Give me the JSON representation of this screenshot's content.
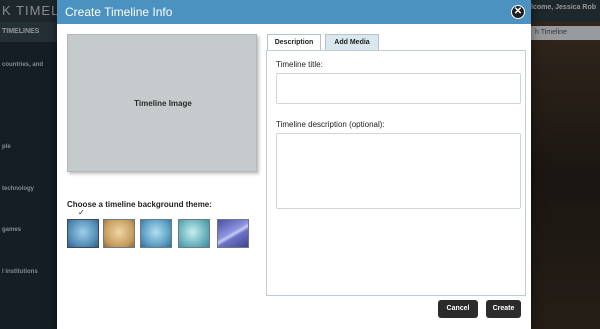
{
  "background_app": {
    "logo": "K TIMELINE",
    "welcome": "Welcome, Jessica Rob",
    "sidebar_header": "TIMELINES",
    "sidebar_items": [
      "countries, and",
      "ple",
      "technology",
      "games",
      "l institutions"
    ],
    "search_placeholder": "h Timeline"
  },
  "dialog": {
    "title": "Create Timeline Info",
    "close_icon": "close-icon",
    "image_placeholder": "Timeline Image",
    "theme_label": "Choose a timeline background theme:",
    "selected_theme_index": 0,
    "themes": [
      {
        "name": "blue",
        "color": "#4f88b3"
      },
      {
        "name": "tan",
        "color": "#c59a5d"
      },
      {
        "name": "light-blue",
        "color": "#5b9ec3"
      },
      {
        "name": "teal",
        "color": "#6ab3bd"
      },
      {
        "name": "purple",
        "color": "#6d73c6"
      }
    ],
    "tabs": [
      {
        "label": "Description",
        "active": true
      },
      {
        "label": "Add Media",
        "active": false
      }
    ],
    "fields": {
      "title_label": "Timeline title:",
      "title_value": "",
      "description_label": "Timeline description (optional):",
      "description_value": ""
    },
    "buttons": {
      "cancel": "Cancel",
      "create": "Create"
    },
    "colors": {
      "header": "#4b92c0",
      "button": "#2b2b2b"
    }
  }
}
